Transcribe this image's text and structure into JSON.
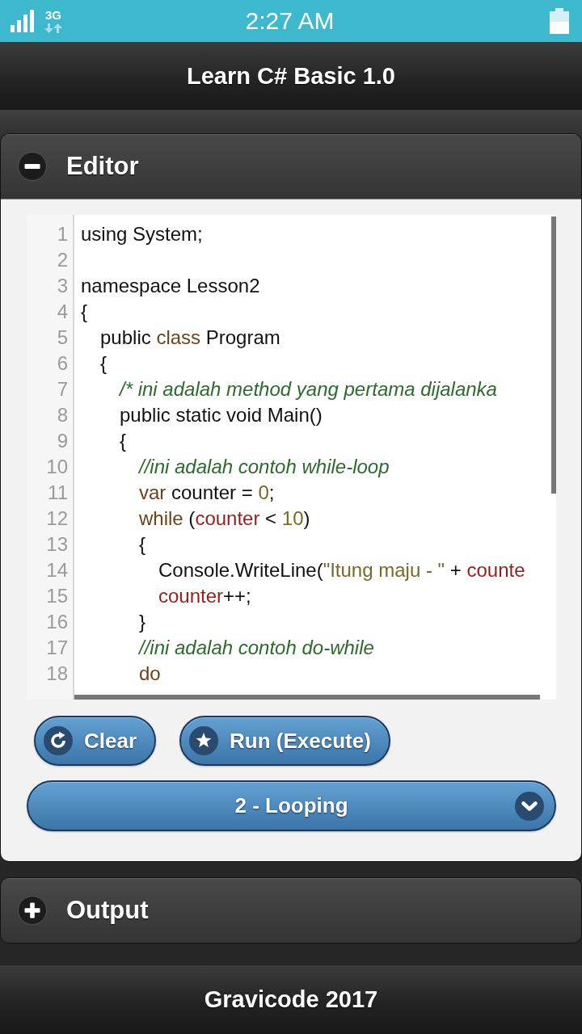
{
  "status_bar": {
    "network_type": "3G",
    "time": "2:27 AM"
  },
  "app_bar": {
    "title": "Learn C# Basic 1.0"
  },
  "sections": [
    {
      "title": "Editor",
      "expanded": true,
      "editor": {
        "lines": [
          {
            "number": "1",
            "tokens": [
              {
                "text": "using System;",
                "kind": "plain"
              }
            ]
          },
          {
            "number": "2"
          },
          {
            "number": "3",
            "tokens": [
              {
                "text": "namespace Lesson2",
                "kind": "plain"
              }
            ]
          },
          {
            "number": "4",
            "tokens": [
              {
                "text": "{",
                "kind": "plain"
              }
            ]
          },
          {
            "number": "5",
            "tokens": [
              {
                "text": "\tpublic ",
                "kind": "plain"
              },
              {
                "text": "class",
                "kind": "keyword"
              },
              {
                "text": " Program",
                "kind": "plain"
              }
            ]
          },
          {
            "number": "6",
            "tokens": [
              {
                "text": "\t{",
                "kind": "plain"
              }
            ]
          },
          {
            "number": "7",
            "tokens": [
              {
                "text": "\t\t/* ini adalah method yang pertama dijalanka",
                "kind": "comment"
              }
            ]
          },
          {
            "number": "8",
            "tokens": [
              {
                "text": "\t\tpublic static void Main()",
                "kind": "plain"
              }
            ]
          },
          {
            "number": "9",
            "tokens": [
              {
                "text": "\t\t{",
                "kind": "plain"
              }
            ]
          },
          {
            "number": "10",
            "tokens": [
              {
                "text": "\t\t\t//ini adalah contoh while-loop",
                "kind": "comment"
              }
            ]
          },
          {
            "number": "11",
            "tokens": [
              {
                "text": "\t\t\tvar",
                "kind": "keyword"
              },
              {
                "text": " counter = ",
                "kind": "plain"
              },
              {
                "text": "0",
                "kind": "number"
              },
              {
                "text": ";",
                "kind": "plain"
              }
            ]
          },
          {
            "number": "12",
            "tokens": [
              {
                "text": "\t\t\twhile",
                "kind": "keyword"
              },
              {
                "text": " (",
                "kind": "plain"
              },
              {
                "text": "counter",
                "kind": "variable"
              },
              {
                "text": " < ",
                "kind": "plain"
              },
              {
                "text": "10",
                "kind": "number"
              },
              {
                "text": ")",
                "kind": "plain"
              }
            ]
          },
          {
            "number": "13",
            "tokens": [
              {
                "text": "\t\t\t{",
                "kind": "plain"
              }
            ]
          },
          {
            "number": "14",
            "tokens": [
              {
                "text": "\t\t\t\tConsole.WriteLine(",
                "kind": "plain"
              },
              {
                "text": "\"Itung maju - \"",
                "kind": "string"
              },
              {
                "text": " + ",
                "kind": "plain"
              },
              {
                "text": "counte",
                "kind": "variable"
              }
            ]
          },
          {
            "number": "15",
            "tokens": [
              {
                "text": "\t\t\t\tcounter",
                "kind": "variable"
              },
              {
                "text": "++;",
                "kind": "plain"
              }
            ]
          },
          {
            "number": "16",
            "tokens": [
              {
                "text": "\t\t\t}",
                "kind": "plain"
              }
            ]
          },
          {
            "number": "17",
            "tokens": [
              {
                "text": "\t\t\t//ini adalah contoh do-while",
                "kind": "comment"
              }
            ]
          },
          {
            "number": "18",
            "tokens": [
              {
                "text": "\t\t\tdo",
                "kind": "keyword"
              }
            ]
          }
        ]
      },
      "buttons": [
        {
          "label": "Clear",
          "kind": "clear"
        },
        {
          "label": "Run (Execute)",
          "kind": "run"
        }
      ],
      "lesson_select": {
        "value": "2 - Looping"
      }
    },
    {
      "title": "Output",
      "expanded": false
    }
  ],
  "footer": {
    "text": "Gravicode 2017"
  }
}
